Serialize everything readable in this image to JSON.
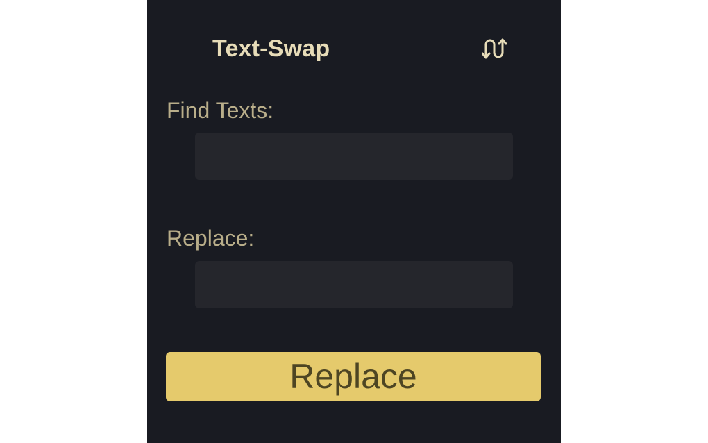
{
  "header": {
    "title": "Text-Swap",
    "icon": "swap-arrows-icon"
  },
  "form": {
    "find_label": "Find Texts:",
    "find_value": "",
    "replace_label": "Replace:",
    "replace_value": "",
    "submit_label": "Replace"
  },
  "colors": {
    "panel_background": "#191b22",
    "field_background": "#25262c",
    "label": "#b9ae8a",
    "title": "#e7dcb8",
    "button_background": "#e5ca6c",
    "button_text": "#4d4523"
  }
}
